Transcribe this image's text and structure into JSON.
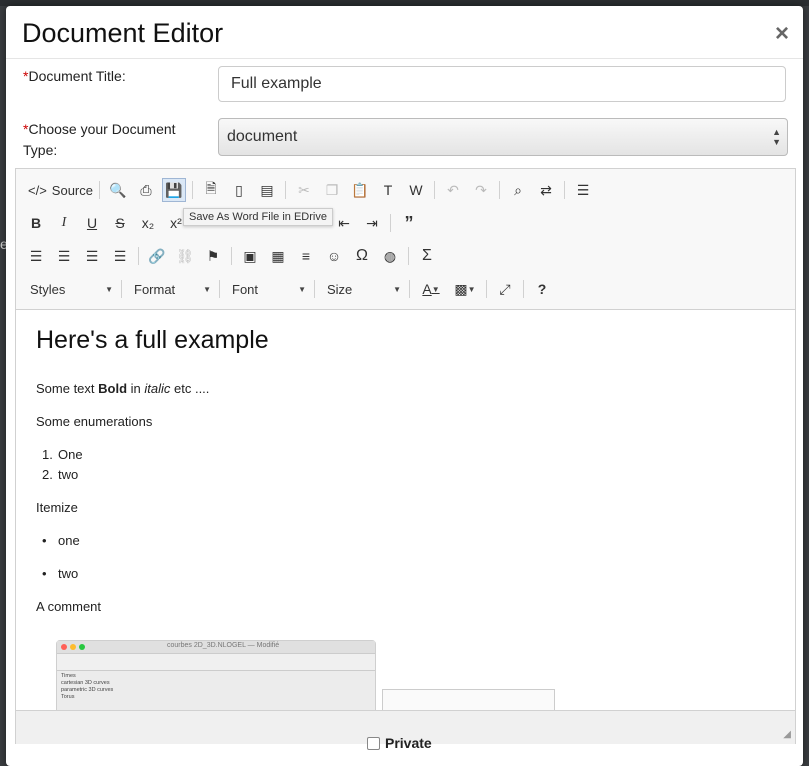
{
  "modal": {
    "title": "Document Editor",
    "close_glyph": "×"
  },
  "form": {
    "title_label": "Document Title:",
    "title_required": "*",
    "title_value": "Full example",
    "type_label": "Choose your Document Type:",
    "type_required": "*",
    "type_value": "document"
  },
  "toolbar": {
    "source_label": "Source",
    "tooltip": "Save As Word File in EDrive",
    "row1_icons": [
      "source-icon",
      "preview-icon",
      "print-icon",
      "save-as-word-icon",
      "new-page-icon",
      "blank-page-icon",
      "templates-icon",
      "cut-icon",
      "copy-icon",
      "paste-icon",
      "paste-text-icon",
      "paste-word-icon",
      "undo-icon",
      "redo-icon",
      "find-icon",
      "replace-icon",
      "select-all-icon"
    ],
    "row2_icons": [
      "bold-icon",
      "italic-icon",
      "underline-icon",
      "strike-icon",
      "subscript-icon",
      "superscript-icon",
      "indent-icon",
      "blockquote-icon"
    ],
    "row3_icons": [
      "align-left-icon",
      "align-center-icon",
      "align-right-icon",
      "justify-icon",
      "link-icon",
      "unlink-icon",
      "anchor-icon",
      "image-icon",
      "table-icon",
      "horizontal-rule-icon",
      "smiley-icon",
      "omega-icon",
      "iframe-icon",
      "sigma-icon"
    ],
    "styles_label": "Styles",
    "format_label": "Format",
    "font_label": "Font",
    "size_label": "Size"
  },
  "content": {
    "heading": "Here's a full example",
    "p1_before": "Some text ",
    "p1_bold": "Bold",
    "p1_mid": " in ",
    "p1_italic": "italic",
    "p1_after": " etc ....",
    "enum_intro": "Some enumerations",
    "ordered": [
      "One",
      "two"
    ],
    "itemize_intro": "Itemize",
    "unordered": [
      "one",
      "two"
    ],
    "comment": "A comment",
    "embedded_title": "courbes 2D_3D.NLOGEL — Modifié",
    "embedded_sidebar": [
      "Times",
      "cartesian 3D curves",
      "parametric 3D curves",
      "Torus"
    ]
  },
  "footer": {
    "private_label": "Private"
  },
  "colors": {
    "required": "#cc0000",
    "active_button": "#dbe8f6",
    "toolbar_bg": "#f8f8f8"
  }
}
